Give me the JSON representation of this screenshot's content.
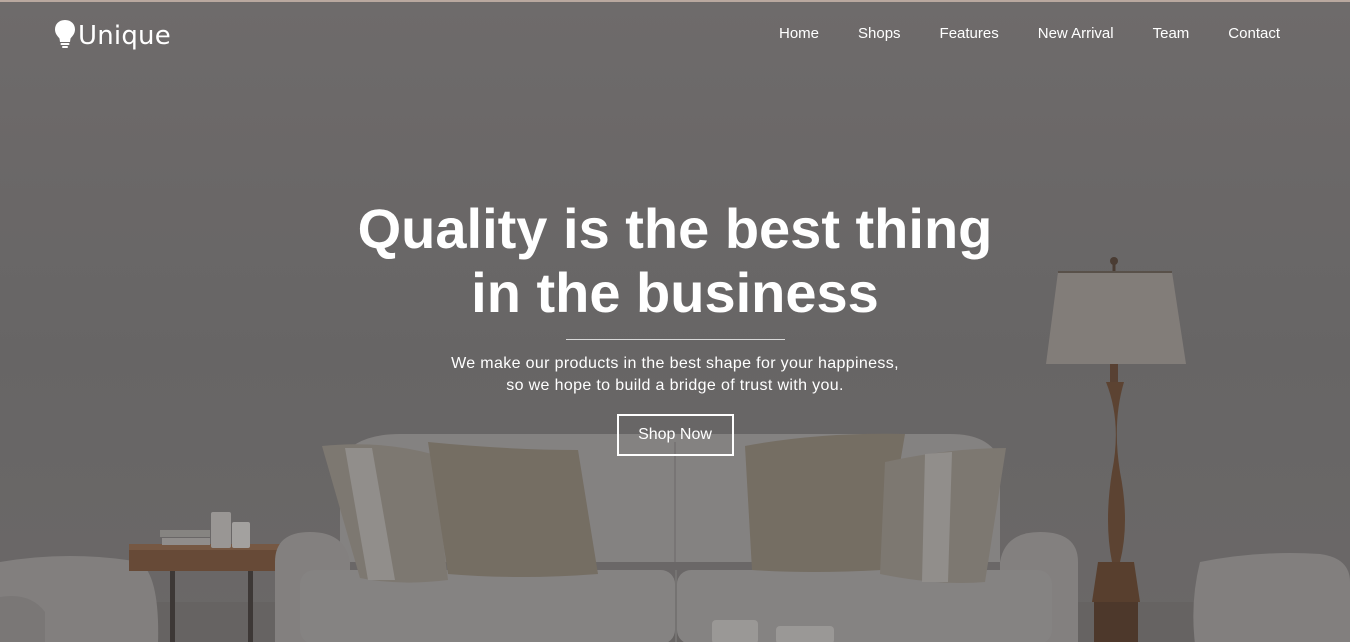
{
  "brand": {
    "name": "Unique",
    "icon": "lightbulb-icon"
  },
  "nav": {
    "items": [
      {
        "label": "Home"
      },
      {
        "label": "Shops"
      },
      {
        "label": "Features"
      },
      {
        "label": "New Arrival"
      },
      {
        "label": "Team"
      },
      {
        "label": "Contact"
      }
    ]
  },
  "hero": {
    "headline_line1": "Quality is the best thing",
    "headline_line2": "in the business",
    "subtext_line1": "We make our products in the best shape for your happiness,",
    "subtext_line2": "so we hope to build a bridge of trust with you.",
    "cta_label": "Shop Now"
  },
  "colors": {
    "overlay": "#6b6868",
    "text": "#ffffff",
    "accent_line": "#d8d8d8"
  }
}
